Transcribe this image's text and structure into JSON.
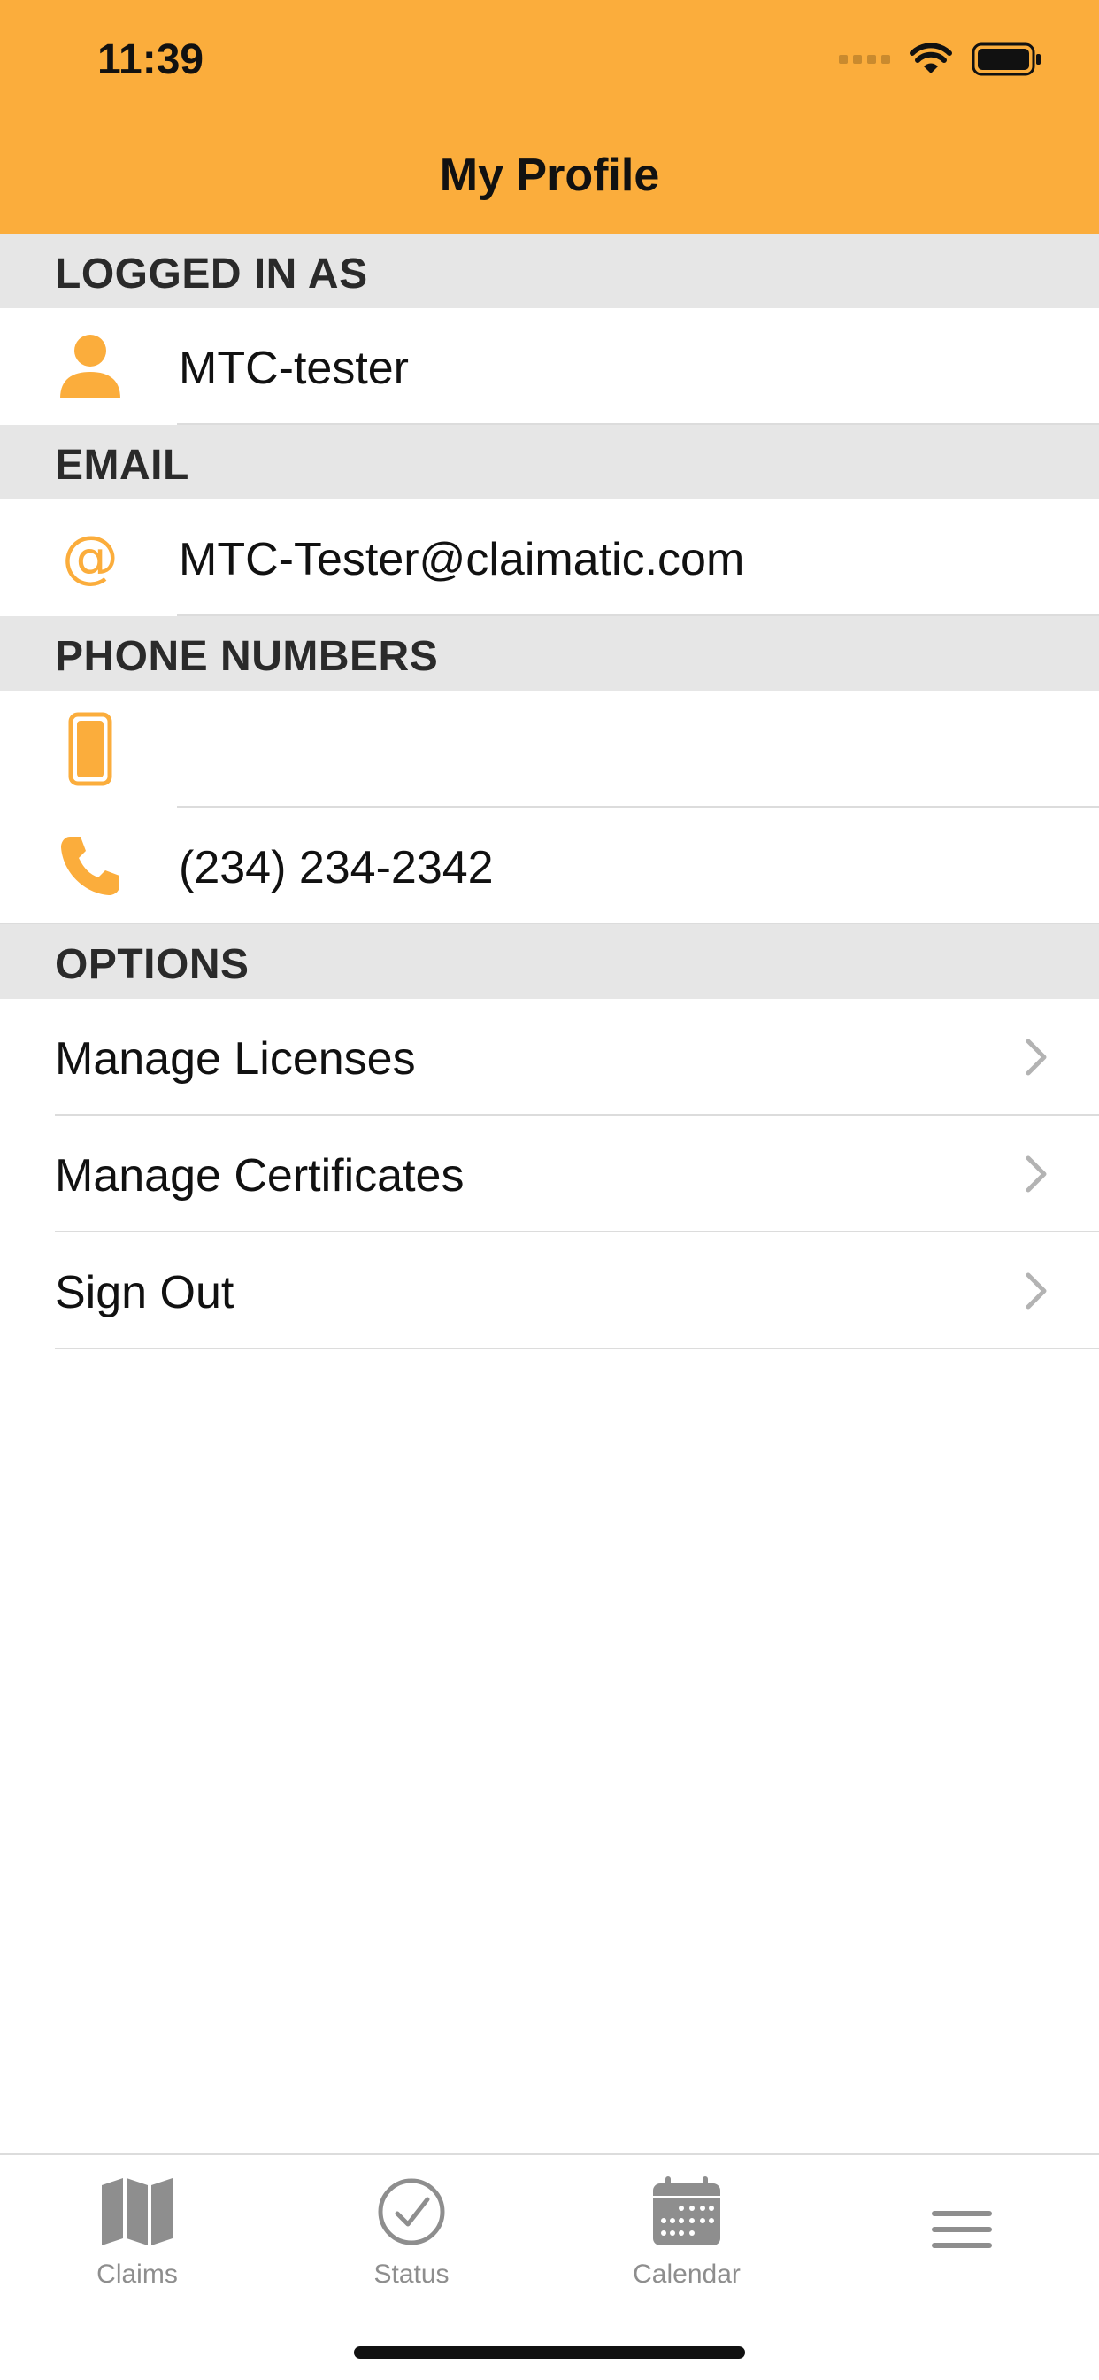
{
  "status_bar": {
    "time": "11:39"
  },
  "header": {
    "title": "My Profile"
  },
  "colors": {
    "accent": "#FBAD3C",
    "section_bg": "#E6E6E6",
    "tab_gray": "#8E8E8E"
  },
  "sections": {
    "logged_in": {
      "title": "LOGGED IN AS",
      "icon": "person-icon",
      "value": "MTC-tester"
    },
    "email": {
      "title": "EMAIL",
      "icon": "at-icon",
      "value": "MTC-Tester@claimatic.com"
    },
    "phones": {
      "title": "PHONE NUMBERS",
      "mobile": {
        "icon": "mobile-phone-icon",
        "value": ""
      },
      "landline": {
        "icon": "phone-handset-icon",
        "value": "(234) 234-2342"
      }
    },
    "options": {
      "title": "OPTIONS",
      "items": [
        {
          "label": "Manage Licenses",
          "icon": "chevron-right-icon"
        },
        {
          "label": "Manage Certificates",
          "icon": "chevron-right-icon"
        },
        {
          "label": "Sign Out",
          "icon": "chevron-right-icon"
        }
      ]
    }
  },
  "tabbar": {
    "tabs": [
      {
        "label": "Claims",
        "icon": "map-icon"
      },
      {
        "label": "Status",
        "icon": "checkmark-circle-icon"
      },
      {
        "label": "Calendar",
        "icon": "calendar-icon"
      },
      {
        "label": "",
        "icon": "menu-icon"
      }
    ]
  }
}
